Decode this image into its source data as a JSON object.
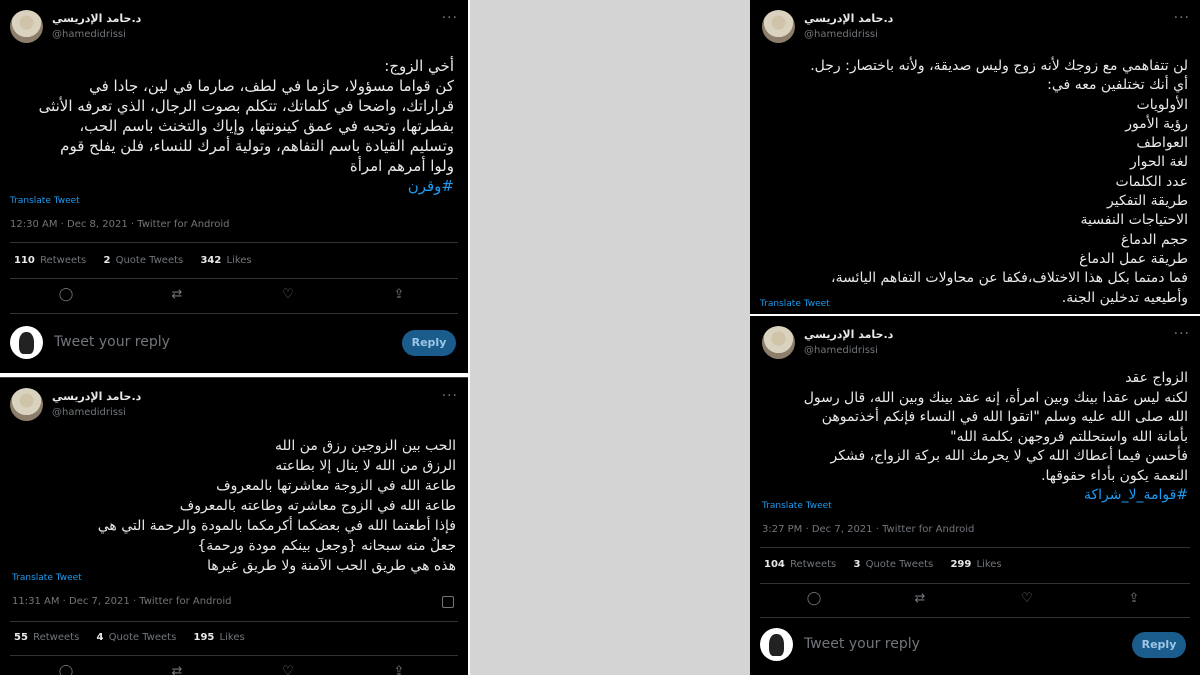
{
  "p1": {
    "author": {
      "name": "د.حامد الإدريسي",
      "handle": "@hamedidrissi"
    },
    "lines": [
      "أخي الزوج:",
      "كن قواما مسؤولا، حازما في لطف، صارما في لين، جادا في",
      "قراراتك، واضحا في كلماتك، تتكلم بصوت الرجال، الذي تعرفه الأنثى",
      "بفطرتها، وتحبه في عمق كينونتها، وإياك والتخنث باسم الحب،",
      "وتسليم القيادة باسم التفاهم، وتولية أمرك للنساء، فلن يفلح قوم",
      "ولوا أمرهم امرأة"
    ],
    "hashtag": "#وقرن",
    "translate": "Translate Tweet",
    "meta": "12:30 AM · Dec 8, 2021 · Twitter for Android",
    "retweets": "110",
    "retweets_label": "Retweets",
    "quotes": "2",
    "quotes_label": "Quote Tweets",
    "likes": "342",
    "likes_label": "Likes",
    "reply_placeholder": "Tweet your reply",
    "reply_button": "Reply"
  },
  "p2": {
    "author": {
      "name": "د.حامد الإدريسي",
      "handle": "@hamedidrissi"
    },
    "lines": [
      "الحب بين الزوجين رزق من الله",
      "الرزق من الله لا ينال إلا بطاعته",
      "طاعة الله في الزوجة معاشرتها بالمعروف",
      "طاعة الله في الزوج معاشرته وطاعته بالمعروف",
      "فإذا أطعتما الله في بعضكما أكرمكما بالمودة والرحمة التي هي",
      "جعلٌ منه سبحانه {وجعل بينكم مودة ورحمة}",
      "هذه هي طريق الحب الآمنة ولا طريق غيرها"
    ],
    "translate": "Translate Tweet",
    "meta": "11:31 AM · Dec 7, 2021 · Twitter for Android",
    "retweets": "55",
    "retweets_label": "Retweets",
    "quotes": "4",
    "quotes_label": "Quote Tweets",
    "likes": "195",
    "likes_label": "Likes"
  },
  "p3": {
    "author": {
      "name": "د.حامد الإدريسي",
      "handle": "@hamedidrissi"
    },
    "lines": [
      "لن تتفاهمي مع زوجك لأنه زوج وليس صديقة، ولأنه باختصار: رجل.",
      "أي أنك تختلفين معه في:",
      "الأولويات",
      "رؤية الأمور",
      "العواطف",
      "لغة الحوار",
      "عدد الكلمات",
      "طريقة التفكير",
      "الاحتياجات النفسية",
      "حجم الدماغ",
      "طريقة عمل الدماغ",
      "فما دمتما بكل هذا الاختلاف،فكفا عن محاولات التفاهم اليائسة،",
      "وأطيعيه تدخلين الجنة."
    ],
    "translate": "Translate Tweet"
  },
  "p4": {
    "author": {
      "name": "د.حامد الإدريسي",
      "handle": "@hamedidrissi"
    },
    "lines": [
      "الزواج عقد",
      "لكنه ليس عقدا بينك وبين امرأة، إنه عقد بينك وبين الله، قال رسول",
      "الله صلى الله عليه وسلم \"اتقوا الله في النساء فإنكم أخذتموهن",
      "بأمانة الله واستحللتم فروجهن بكلمة الله\"",
      "فأحسن فيما أعطاك الله كي لا يحرمك الله بركة الزواج، فشكر",
      "النعمة يكون بأداء حقوقها."
    ],
    "hashtag": "#قوامة_لا_شراكة",
    "translate": "Translate Tweet",
    "meta": "3:27 PM · Dec 7, 2021 · Twitter for Android",
    "retweets": "104",
    "retweets_label": "Retweets",
    "quotes": "3",
    "quotes_label": "Quote Tweets",
    "likes": "299",
    "likes_label": "Likes",
    "reply_placeholder": "Tweet your reply",
    "reply_button": "Reply"
  },
  "icons": [
    "reply-icon",
    "retweet-icon",
    "like-icon",
    "share-icon",
    "more-icon"
  ]
}
